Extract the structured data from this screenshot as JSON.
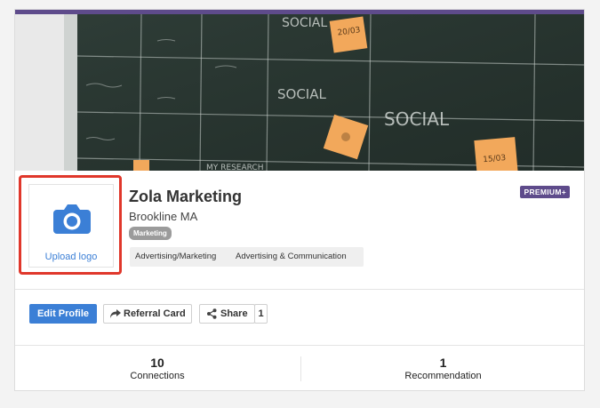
{
  "profile": {
    "company_name": "Zola Marketing",
    "location": "Brookline MA",
    "category": "Marketing",
    "tags": [
      "Advertising/Marketing",
      "Advertising & Communication"
    ],
    "premium_badge": "PREMIUM+",
    "upload_logo_label": "Upload logo"
  },
  "cover": {
    "notes": [
      "20/03",
      "15/03"
    ],
    "chalk_words": [
      "SOCIAL",
      "SOCIAL",
      "SOCIAL",
      "MY RESEARCH"
    ]
  },
  "actions": {
    "edit_profile": "Edit Profile",
    "referral_card": "Referral Card",
    "share": "Share",
    "share_count": "1"
  },
  "stats": {
    "connections": {
      "value": "10",
      "label": "Connections"
    },
    "recommendations": {
      "value": "1",
      "label": "Recommendation"
    }
  },
  "colors": {
    "accent_purple": "#5e4b8b",
    "primary_blue": "#3b7fd6",
    "highlight_red": "#e0372b",
    "sticky_note": "#f2a85b"
  },
  "icons": [
    "camera-icon",
    "share-arrow-icon",
    "share-icon"
  ]
}
